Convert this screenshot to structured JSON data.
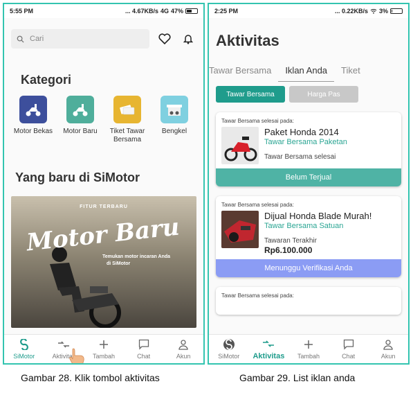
{
  "left": {
    "status": {
      "time": "5:55 PM",
      "network": "... 4.67KB/s",
      "signal": "4G",
      "battery": "47%",
      "battery_level": 0.47
    },
    "search": {
      "placeholder": "Cari"
    },
    "kategori_title": "Kategori",
    "categories": [
      {
        "label": "Motor Bekas",
        "color": "#3d4f9c",
        "icon": "scooter-icon"
      },
      {
        "label": "Motor Baru",
        "color": "#4fae9b",
        "icon": "scooter-icon"
      },
      {
        "label": "Tiket Tawar Bersama",
        "color": "#e7b531",
        "icon": "ticket-icon"
      },
      {
        "label": "Bengkel",
        "color": "#7fd0e0",
        "icon": "workshop-icon"
      }
    ],
    "new_title": "Yang baru di SiMotor",
    "banner": {
      "feature": "FITUR TERBARU",
      "title": "Motor Baru",
      "subtitle_1": "Temukan motor incaran Anda",
      "subtitle_2": "di SiMotor"
    },
    "nav": [
      {
        "label": "SiMotor",
        "icon": "simotor-logo-icon"
      },
      {
        "label": "Aktivitas",
        "icon": "activity-icon"
      },
      {
        "label": "Tambah",
        "icon": "plus-icon"
      },
      {
        "label": "Chat",
        "icon": "chat-icon"
      },
      {
        "label": "Akun",
        "icon": "user-icon"
      }
    ],
    "caption": "Gambar 28. Klik tombol aktivitas"
  },
  "right": {
    "status": {
      "time": "2:25 PM",
      "network": "... 0.22KB/s",
      "battery": "3%",
      "battery_level": 0.03
    },
    "title": "Aktivitas",
    "tabs": [
      "Tawar Bersama",
      "Iklan Anda",
      "Tiket"
    ],
    "filters": [
      "Tawar Bersama",
      "Harga Pas"
    ],
    "cards": [
      {
        "head": "Tawar Bersama selesai pada:",
        "title": "Paket Honda 2014",
        "sub": "Tawar Bersama Paketan",
        "status": "Tawar Bersama selesai",
        "price": "",
        "footer": "Belum Terjual"
      },
      {
        "head": "Tawar Bersama selesai pada:",
        "title": "Dijual Honda Blade Murah!",
        "sub": "Tawar Bersama Satuan",
        "status": "Tawaran Terakhir",
        "price": "Rp6.100.000",
        "footer": "Menunggu Verifikasi Anda"
      },
      {
        "head": "Tawar Bersama selesai pada:"
      }
    ],
    "nav": [
      {
        "label": "SiMotor",
        "icon": "simotor-logo-icon"
      },
      {
        "label": "Aktivitas",
        "icon": "activity-icon"
      },
      {
        "label": "Tambah",
        "icon": "plus-icon"
      },
      {
        "label": "Chat",
        "icon": "chat-icon"
      },
      {
        "label": "Akun",
        "icon": "user-icon"
      }
    ],
    "caption": "Gambar 29. List iklan anda"
  },
  "colors": {
    "accent": "#1f9c8c",
    "border": "#33c4b0",
    "footer_teal": "#4fb3a5",
    "footer_blue": "#8b9cf4"
  }
}
